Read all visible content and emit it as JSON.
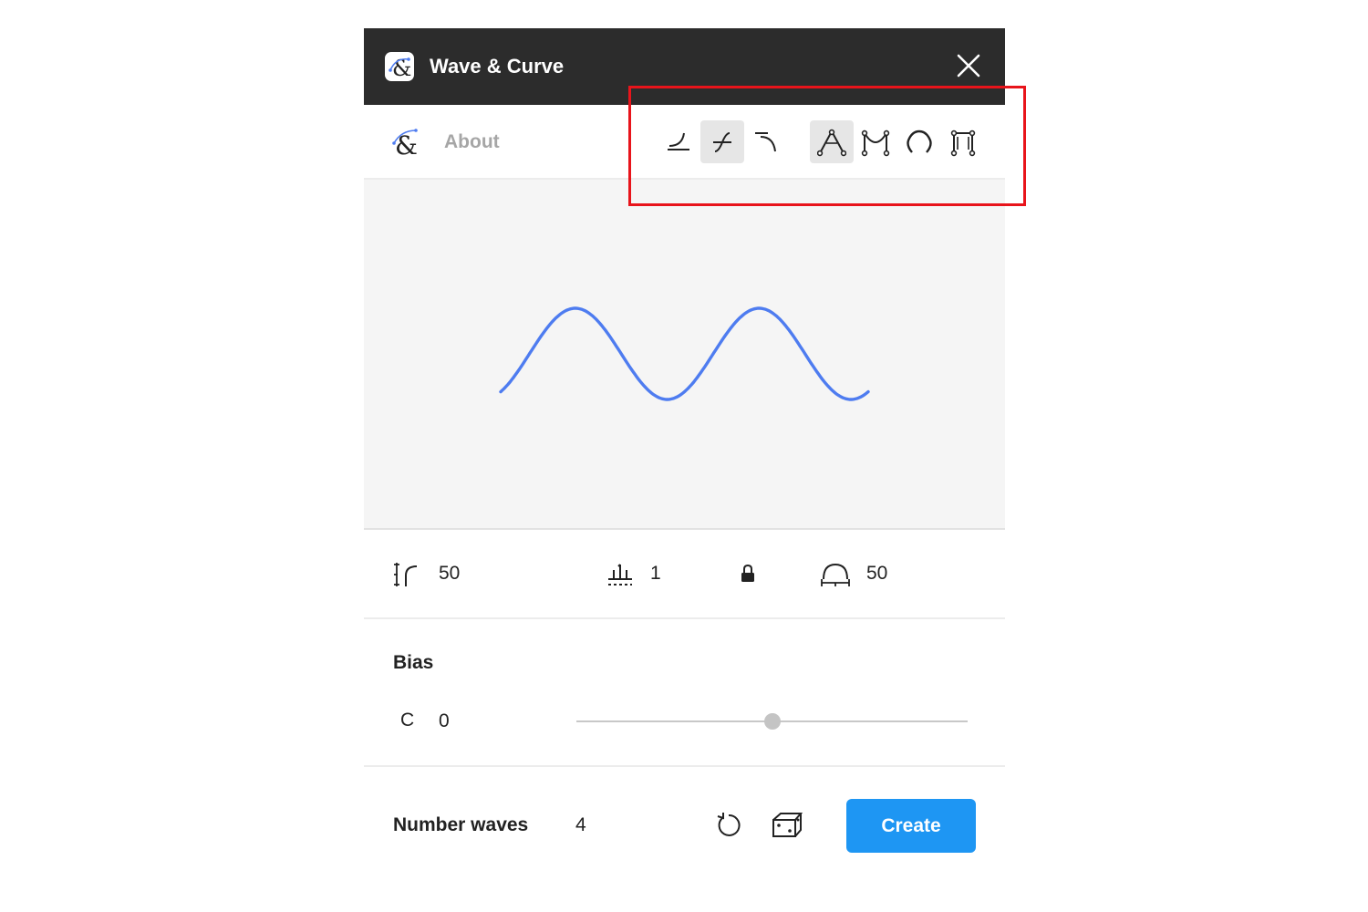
{
  "window": {
    "title": "Wave & Curve",
    "logo_icon": "ampersand-curve-logo",
    "close_icon": "close-icon"
  },
  "toolbar": {
    "about_label": "About",
    "curve_types": [
      {
        "icon": "ease-in-curve-icon",
        "active": false
      },
      {
        "icon": "s-curve-icon",
        "active": true
      },
      {
        "icon": "ease-out-curve-icon",
        "active": false
      }
    ],
    "wave_shapes": [
      {
        "icon": "triangle-wave-icon",
        "active": true
      },
      {
        "icon": "bezier-wave-icon",
        "active": false
      },
      {
        "icon": "round-wave-icon",
        "active": false
      },
      {
        "icon": "square-wave-icon",
        "active": false
      }
    ]
  },
  "preview": {
    "wave_color": "#4e7cf0",
    "background": "#f5f5f5"
  },
  "params": {
    "height": {
      "icon": "wave-height-icon",
      "value": "50"
    },
    "count": {
      "icon": "wave-count-icon",
      "value": "1"
    },
    "lock": {
      "icon": "lock-icon",
      "locked": true
    },
    "width": {
      "icon": "wave-width-icon",
      "value": "50"
    }
  },
  "bias": {
    "label": "Bias",
    "icon_text": "C",
    "value": "0",
    "slider_fraction": 0.5
  },
  "footer": {
    "number_waves_label": "Number waves",
    "number_waves_value": "4",
    "reset_icon": "reset-icon",
    "random_icon": "dice-icon",
    "create_label": "Create"
  },
  "colors": {
    "titlebar": "#2c2c2c",
    "accent": "#1e96f3",
    "highlight": "#e8141b"
  }
}
